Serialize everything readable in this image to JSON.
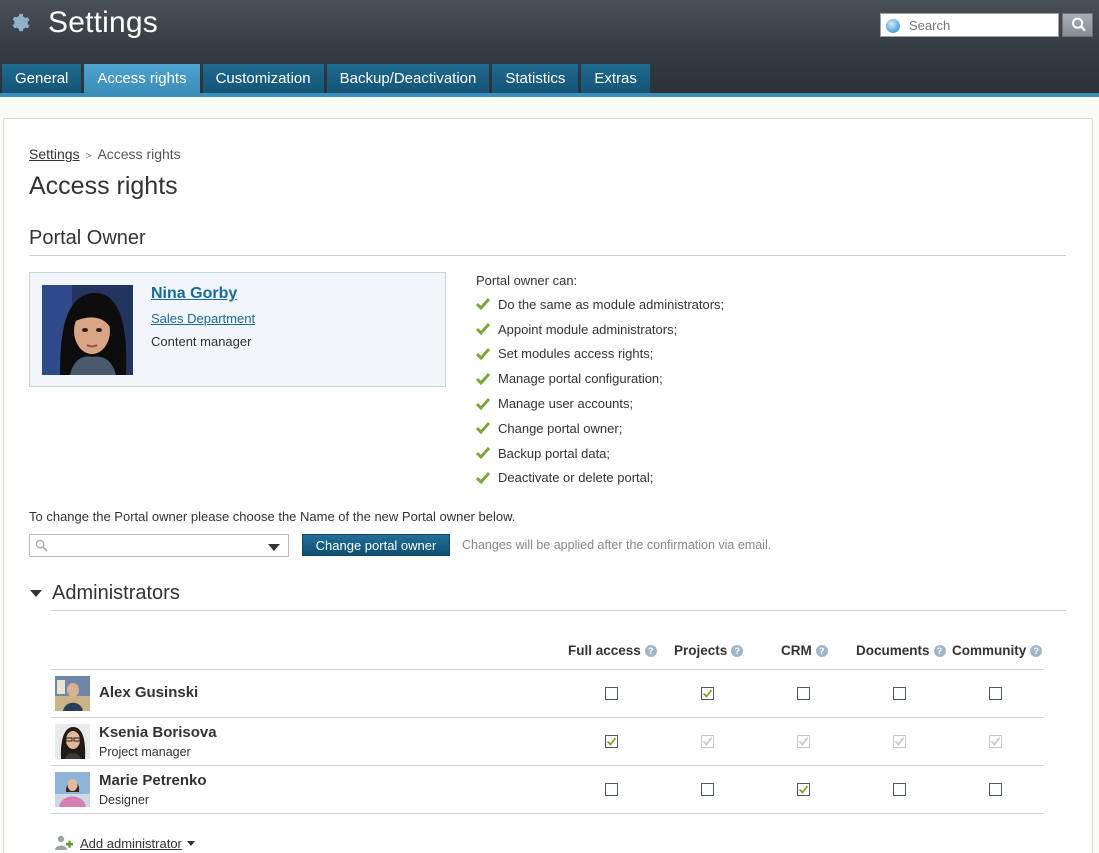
{
  "header": {
    "title": "Settings",
    "search_placeholder": "Search",
    "tabs": [
      {
        "label": "General",
        "active": false
      },
      {
        "label": "Access rights",
        "active": true
      },
      {
        "label": "Customization",
        "active": false
      },
      {
        "label": "Backup/Deactivation",
        "active": false
      },
      {
        "label": "Statistics",
        "active": false
      },
      {
        "label": "Extras",
        "active": false
      }
    ]
  },
  "breadcrumb": {
    "root": "Settings",
    "separator": ">",
    "current": "Access rights"
  },
  "page_title": "Access rights",
  "portal_owner": {
    "section_title": "Portal Owner",
    "name": "Nina Gorby",
    "department": "Sales Department",
    "role": "Content manager",
    "can_title": "Portal owner can:",
    "can_items": [
      "Do the same as module administrators;",
      "Appoint module administrators;",
      "Set modules access rights;",
      "Manage portal configuration;",
      "Manage user accounts;",
      "Change portal owner;",
      "Backup portal data;",
      "Deactivate or delete portal;"
    ],
    "change_instruction": "To change the Portal owner please choose the Name of the new Portal owner below.",
    "change_button": "Change portal owner",
    "change_note": "Changes will be applied after the confirmation via email."
  },
  "administrators": {
    "section_title": "Administrators",
    "columns": [
      "Full access",
      "Projects",
      "CRM",
      "Documents",
      "Community"
    ],
    "help_glyph": "?",
    "rows": [
      {
        "name": "Alex Gusinski",
        "role": "",
        "checks": [
          false,
          true,
          false,
          false,
          false
        ],
        "disabled": [
          false,
          false,
          false,
          false,
          false
        ]
      },
      {
        "name": "Ksenia Borisova",
        "role": "Project manager",
        "checks": [
          true,
          true,
          true,
          true,
          true
        ],
        "disabled": [
          false,
          true,
          true,
          true,
          true
        ]
      },
      {
        "name": "Marie Petrenko",
        "role": "Designer",
        "checks": [
          false,
          false,
          true,
          false,
          false
        ],
        "disabled": [
          false,
          false,
          false,
          false,
          false
        ]
      }
    ],
    "add_label": "Add administrator"
  },
  "colors": {
    "accent": "#3b8dba",
    "tab_dark": "#155476",
    "link": "#1b6a9e",
    "check_green": "#7ba63a"
  }
}
